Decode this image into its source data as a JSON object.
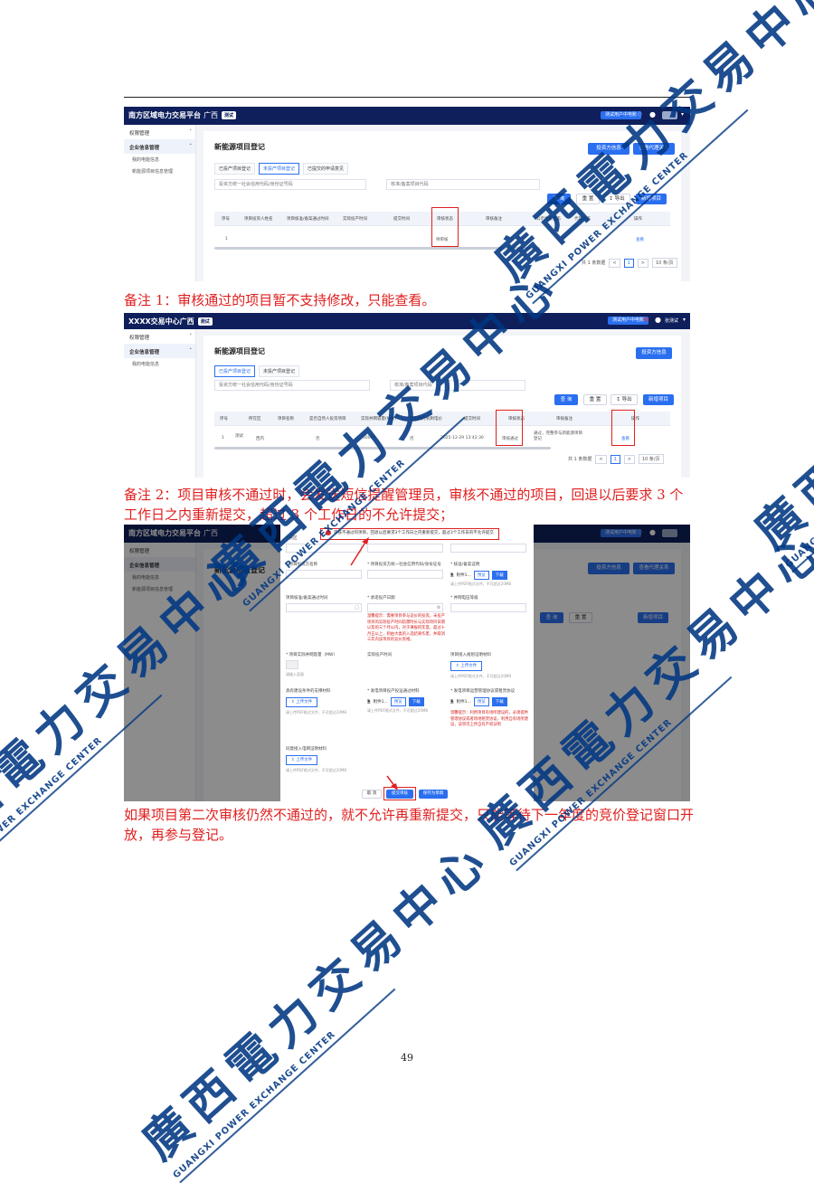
{
  "app": {
    "brand": "南方区域电力交易平台",
    "brand_alt": "XXXX交易中心广西",
    "region": "广西",
    "env_badge": "测试",
    "switch_button": "测试用户中电账",
    "user_name": "张测试"
  },
  "sidebar": {
    "group1": "权限管理",
    "group2": "企业信息管理",
    "item1": "我的电能信息",
    "item2": "新能源项目信息管理"
  },
  "screen1": {
    "page_title": "新能源项目登记",
    "btn_investor": "投资方信息",
    "btn_agent": "查看代理关系",
    "tabs": [
      "已投产项目登记",
      "未投产项目登记",
      "已提交的申请意见"
    ],
    "filter1": "投资方统一社会信用代码/身份证号码",
    "filter2": "核准/备案项目代码",
    "btn_query": "查 询",
    "btn_reset": "重 置",
    "btn_export": "导出",
    "btn_add": "新增项目",
    "columns": [
      "序号",
      "项目投资人姓名",
      "项目核准/备案通过时间",
      "实际投产时间",
      "提交时间",
      "审核状态",
      "审核备注",
      "公示生效状态",
      "代理状态",
      "操作"
    ],
    "row": {
      "index": "1",
      "status": "待审核",
      "action": "查看"
    },
    "pager": {
      "total": "共 1 条数据",
      "page": "1",
      "size": "10 条/页"
    }
  },
  "note1": "备注 1：审核通过的项目暂不支持修改，只能查看。",
  "screen2": {
    "page_title": "新能源项目登记",
    "btn_investor": "投资方信息",
    "tabs": [
      "已投产项目登记",
      "未投产项目登记"
    ],
    "filter1": "投资方统一社会信用代码/身份证号码",
    "filter2": "核准/备案项目代码",
    "btn_query": "查 询",
    "btn_reset": "重 置",
    "btn_export": "导出",
    "btn_add": "新增项目",
    "columns": [
      "序号",
      "所在区",
      "项目名称",
      "是否自然人投资项目",
      "实际并网容量(MW)",
      "是否执行机制电价",
      "提交时间",
      "审核状态",
      "审核备注",
      "操作"
    ],
    "row": {
      "index": "1",
      "name": "测试",
      "district": "西内",
      "self_invest": "否",
      "capacity": "50000",
      "mech_price": "否",
      "submit_time": "2025-12-29 13:42:30",
      "status": "审核通过",
      "remark": "通过，完整参与新能源项目登记",
      "action": "查看"
    },
    "pager": {
      "total": "共 1 条数据",
      "page": "1",
      "size": "10 条/页"
    }
  },
  "note2": "备注 2：项目审核不通过时，会发送短信提醒管理员，审核不通过的项目，回退以后要求 3 个工作日之内重新提交，超过 3 个工作日的不允许提交；",
  "screen3": {
    "toast": "审核不通过的项目，回退以后要求3个工作日之内重新提交，超过3个工作日的不允许提交",
    "f_district": "* 县区",
    "f_name": "* 项目投资方名称",
    "f_credit": "* 项目投资方统一社会信用代码/身份证号",
    "f_cert": "* 核准/备案证明",
    "f_approve_time": "项目核准/备案通过时间",
    "f_plan_time": "* 承诺投产日期",
    "f_grid_level": "* 并网电压等级",
    "f_capacity": "* 项目实际并网容量（MW）",
    "f_actual_time": "实际投产时间",
    "f_grid_material": "项目接入规划证明材料",
    "f_support": "具有建设条件的支撑材料",
    "f_power_cert": "* 发电项目投产投运通过材料",
    "f_agreement": "* 发电项目运营管理协议或租赁协议",
    "f_access": "同意接入电网证明材料",
    "attach": "附件1...",
    "preview": "预览",
    "download": "下载",
    "upload": "上传文件",
    "upload_hint": "请上传PDF格式文件，不可超过20MB",
    "warn_plan": "温馨提示：需要项目参与竞价的投资，未投产项目的实际投产时间前需时长与实际项目日期以及的三个月以内，对于填报的年度，超过十月五以上，则由大类的入选结果作废，并取消三年内该项目的竞价资格。",
    "warn_agreement": "温馨提示：利用项目有场所建设的，必须提供管理协议或者场地租赁协议，利用自有场所建设，该项可上传自有产权证明",
    "capacity_unit": "请输入容量",
    "btn_cancel": "取 消",
    "btn_submit": "提交审核",
    "btn_draft": "保存为草稿"
  },
  "note3": "如果项目第二次审核仍然不通过的，就不允许再重新提交，只能等待下一年度的竞价登记窗口开放，再参与登记。",
  "page_number": "49",
  "watermark": {
    "cn": "廣西電力交易中心",
    "en": "GUANGXI POWER EXCHANGE CENTER"
  },
  "colors": {
    "accent": "#2a6ff0",
    "navy": "#0e1f5b",
    "annotation": "#e02020",
    "note_text": "#e01e1e",
    "watermark": "#003782"
  }
}
